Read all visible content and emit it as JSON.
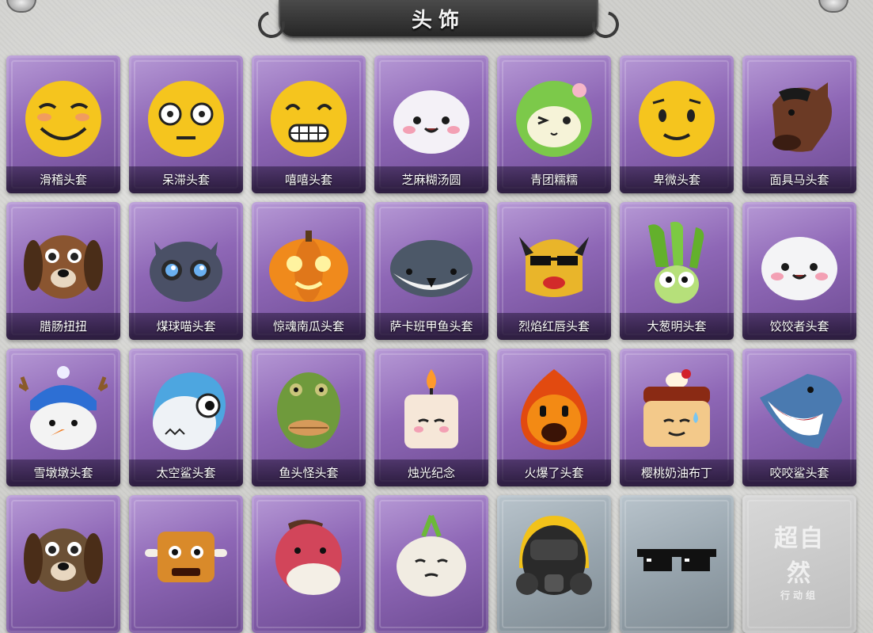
{
  "header": {
    "title": "头饰"
  },
  "items": [
    {
      "label": "滑稽头套",
      "icon": "smirk-face-icon",
      "face": "#f5c51e",
      "kind": "smirk"
    },
    {
      "label": "呆滞头套",
      "icon": "staring-face-icon",
      "face": "#f5c51e",
      "kind": "stare"
    },
    {
      "label": "嘻嘻头套",
      "icon": "grin-face-icon",
      "face": "#f5c51e",
      "kind": "grin"
    },
    {
      "label": "芝麻糊汤圆",
      "icon": "dumpling-icon",
      "face": "#f4f1f7",
      "kind": "cute"
    },
    {
      "label": "青团糯糯",
      "icon": "green-rice-ball-icon",
      "face": "#7cc94a",
      "kind": "wink"
    },
    {
      "label": "卑微头套",
      "icon": "humble-face-icon",
      "face": "#f5c51e",
      "kind": "humble"
    },
    {
      "label": "面具马头套",
      "icon": "horse-mask-icon",
      "face": "#6b3a25",
      "kind": "horse"
    },
    {
      "label": "腊肠扭扭",
      "icon": "dachshund-icon",
      "face": "#8a5530",
      "kind": "dog"
    },
    {
      "label": "煤球喵头套",
      "icon": "black-cat-icon",
      "face": "#4a5066",
      "kind": "cat"
    },
    {
      "label": "惊魂南瓜头套",
      "icon": "pumpkin-icon",
      "face": "#f08a1c",
      "kind": "pumpkin"
    },
    {
      "label": "萨卡班甲鱼头套",
      "icon": "fish-icon",
      "face": "#4c5868",
      "kind": "fish"
    },
    {
      "label": "烈焰红唇头套",
      "icon": "yellow-balaclava-icon",
      "face": "#e9b52a",
      "kind": "lips"
    },
    {
      "label": "大葱明头套",
      "icon": "scallion-icon",
      "face": "#7bc242",
      "kind": "scallion"
    },
    {
      "label": "饺饺者头套",
      "icon": "dumpling-cloud-icon",
      "face": "#f4f4f6",
      "kind": "cute"
    },
    {
      "label": "雪墩墩头套",
      "icon": "snowman-icon",
      "face": "#f3f3f3",
      "kind": "snow"
    },
    {
      "label": "太空鲨头套",
      "icon": "space-shark-icon",
      "face": "#eef2f6",
      "kind": "shark"
    },
    {
      "label": "鱼头怪头套",
      "icon": "fish-monster-icon",
      "face": "#6f9a3c",
      "kind": "fishman"
    },
    {
      "label": "烛光纪念",
      "icon": "candle-icon",
      "face": "#f6e7d8",
      "kind": "candle"
    },
    {
      "label": "火爆了头套",
      "icon": "fireball-icon",
      "face": "#f38a14",
      "kind": "fire"
    },
    {
      "label": "樱桃奶油布丁",
      "icon": "pudding-icon",
      "face": "#f3c98a",
      "kind": "pudding"
    },
    {
      "label": "咬咬鲨头套",
      "icon": "biting-shark-icon",
      "face": "#4a7ab0",
      "kind": "bshark"
    },
    {
      "label": "",
      "icon": "sunglasses-dog-icon",
      "face": "#6b5035",
      "kind": "dog"
    },
    {
      "label": "",
      "icon": "bone-box-icon",
      "face": "#d98a2a",
      "kind": "box"
    },
    {
      "label": "",
      "icon": "red-horse-icon",
      "face": "#d2455a",
      "kind": "redhorse"
    },
    {
      "label": "",
      "icon": "garlic-icon",
      "face": "#f1ece2",
      "kind": "garlic"
    },
    {
      "label": "",
      "icon": "gas-mask-helmet-icon",
      "face": "#2a2a2a",
      "kind": "mask"
    },
    {
      "label": "",
      "icon": "pixel-sunglasses-icon",
      "face": "#111111",
      "kind": "shades"
    },
    {
      "label": "",
      "icon": "empty-slot-icon",
      "face": "",
      "kind": "empty",
      "watermark": "超自然",
      "watermark_sub": "行动组"
    }
  ]
}
